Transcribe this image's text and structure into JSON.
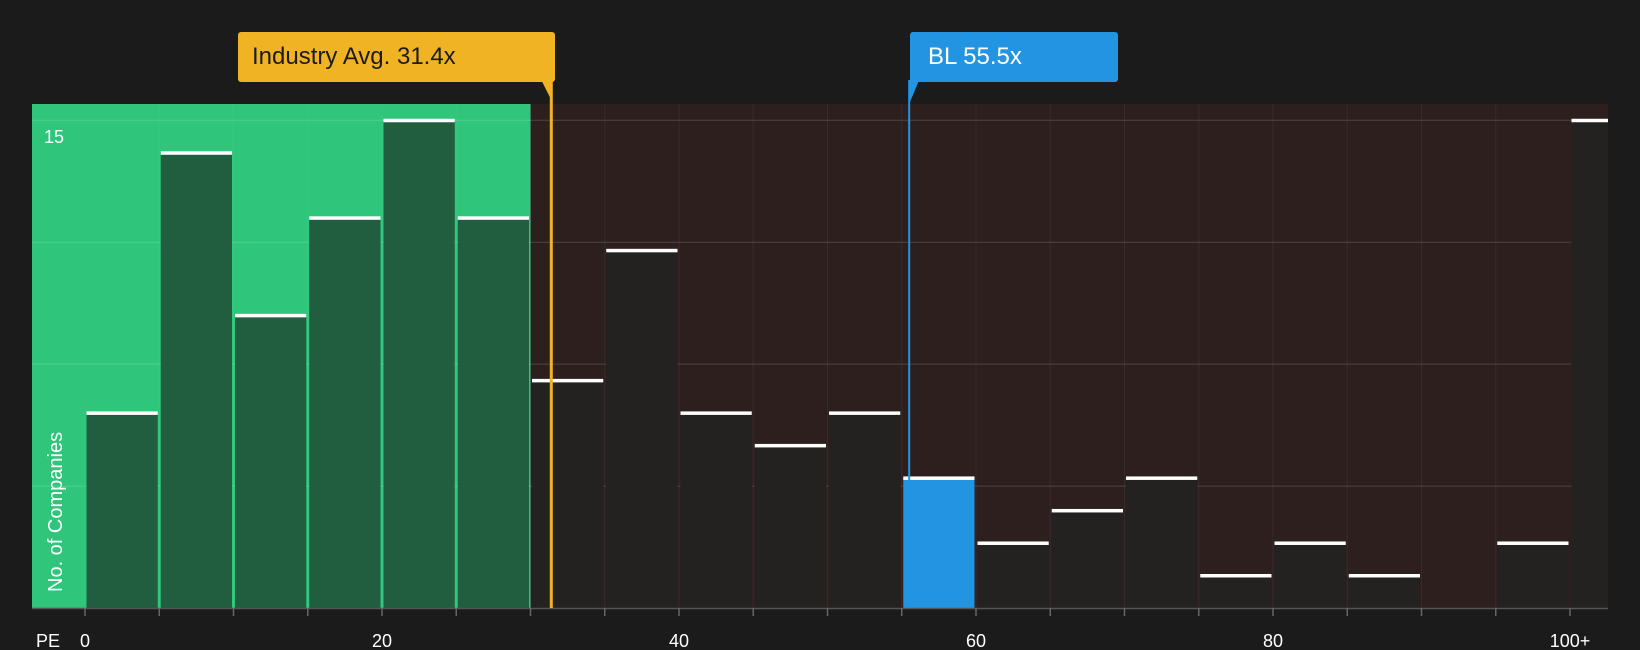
{
  "chart_data": {
    "type": "bar",
    "x_label": "PE",
    "y_label": "No. of Companies",
    "x_ticks": [
      "0",
      "20",
      "40",
      "60",
      "80",
      "100+"
    ],
    "y_ticks": [
      "15"
    ],
    "ylim": [
      0,
      15.5
    ],
    "bins": [
      {
        "start": 0,
        "end": 5,
        "count": 6
      },
      {
        "start": 5,
        "end": 10,
        "count": 14
      },
      {
        "start": 10,
        "end": 15,
        "count": 9
      },
      {
        "start": 15,
        "end": 20,
        "count": 12
      },
      {
        "start": 20,
        "end": 25,
        "count": 15
      },
      {
        "start": 25,
        "end": 30,
        "count": 12
      },
      {
        "start": 30,
        "end": 35,
        "count": 7
      },
      {
        "start": 35,
        "end": 40,
        "count": 11
      },
      {
        "start": 40,
        "end": 45,
        "count": 6
      },
      {
        "start": 45,
        "end": 50,
        "count": 5
      },
      {
        "start": 50,
        "end": 55,
        "count": 6
      },
      {
        "start": 55,
        "end": 60,
        "count": 4
      },
      {
        "start": 60,
        "end": 65,
        "count": 2
      },
      {
        "start": 65,
        "end": 70,
        "count": 3
      },
      {
        "start": 70,
        "end": 75,
        "count": 4
      },
      {
        "start": 75,
        "end": 80,
        "count": 1
      },
      {
        "start": 80,
        "end": 85,
        "count": 2
      },
      {
        "start": 85,
        "end": 90,
        "count": 1
      },
      {
        "start": 90,
        "end": 95,
        "count": 0
      },
      {
        "start": 95,
        "end": 100,
        "count": 2
      },
      {
        "start": 100,
        "end": 105,
        "count": 15
      }
    ],
    "industry_avg": {
      "label": "Industry Avg. 31.4x",
      "value": 31.4
    },
    "company": {
      "label": "BL 55.5x",
      "value": 55.5,
      "bin_start": 55
    },
    "fair_range_max": 30,
    "colors": {
      "background": "#1b1b1b",
      "good_zone": "#2fc57b",
      "bad_zone": "#2e1f1f",
      "industry": "#f0b323",
      "company": "#2394e1",
      "bar_in_good": "#1e4a35",
      "bar_dark": "#242121",
      "cap": "#ffffff"
    }
  }
}
